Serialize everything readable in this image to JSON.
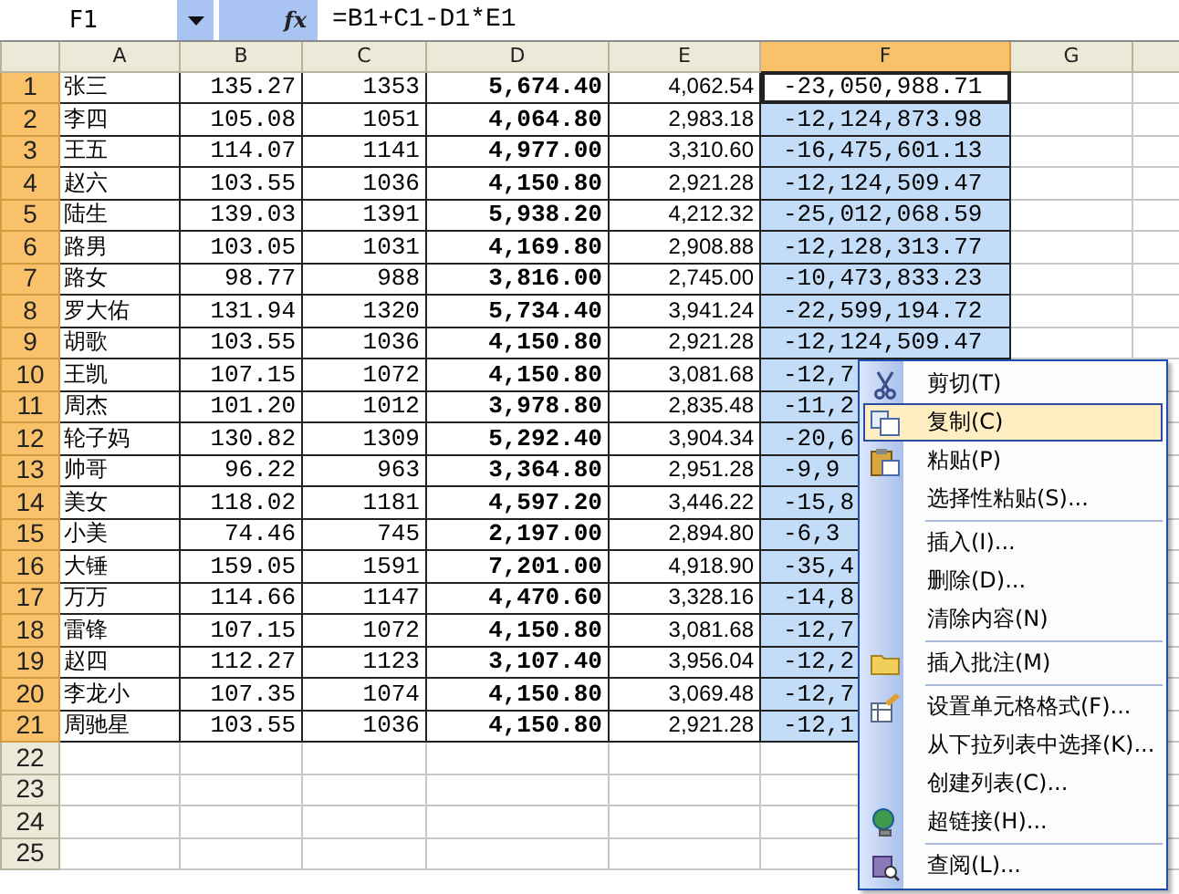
{
  "formula_bar": {
    "name_box": "F1",
    "function_label": "fx",
    "formula": "=B1+C1-D1*E1"
  },
  "sheet": {
    "columns": [
      {
        "label": "A",
        "selected": false
      },
      {
        "label": "B",
        "selected": false
      },
      {
        "label": "C",
        "selected": false
      },
      {
        "label": "D",
        "selected": false
      },
      {
        "label": "E",
        "selected": false
      },
      {
        "label": "F",
        "selected": true
      },
      {
        "label": "G",
        "selected": false
      }
    ],
    "rows": [
      {
        "header": "1",
        "selected": true,
        "active": true,
        "cells": [
          "张三",
          "135.27",
          "1353",
          "5,674.40",
          "4,062.54",
          "-23,050,988.71"
        ]
      },
      {
        "header": "2",
        "selected": true,
        "active": false,
        "cells": [
          "李四",
          "105.08",
          "1051",
          "4,064.80",
          "2,983.18",
          "-12,124,873.98"
        ]
      },
      {
        "header": "3",
        "selected": true,
        "active": false,
        "cells": [
          "王五",
          "114.07",
          "1141",
          "4,977.00",
          "3,310.60",
          "-16,475,601.13"
        ]
      },
      {
        "header": "4",
        "selected": true,
        "active": false,
        "cells": [
          "赵六",
          "103.55",
          "1036",
          "4,150.80",
          "2,921.28",
          "-12,124,509.47"
        ]
      },
      {
        "header": "5",
        "selected": true,
        "active": false,
        "cells": [
          "陆生",
          "139.03",
          "1391",
          "5,938.20",
          "4,212.32",
          "-25,012,068.59"
        ]
      },
      {
        "header": "6",
        "selected": true,
        "active": false,
        "cells": [
          "路男",
          "103.05",
          "1031",
          "4,169.80",
          "2,908.88",
          "-12,128,313.77"
        ]
      },
      {
        "header": "7",
        "selected": true,
        "active": false,
        "cells": [
          "路女",
          "98.77",
          "988",
          "3,816.00",
          "2,745.00",
          "-10,473,833.23"
        ]
      },
      {
        "header": "8",
        "selected": true,
        "active": false,
        "cells": [
          "罗大佑",
          "131.94",
          "1320",
          "5,734.40",
          "3,941.24",
          "-22,599,194.72"
        ]
      },
      {
        "header": "9",
        "selected": true,
        "active": false,
        "cells": [
          "胡歌",
          "103.55",
          "1036",
          "4,150.80",
          "2,921.28",
          "-12,124,509.47"
        ]
      },
      {
        "header": "10",
        "selected": true,
        "active": false,
        "cells": [
          "王凯",
          "107.15",
          "1072",
          "4,150.80",
          "3,081.68",
          "-12,7"
        ]
      },
      {
        "header": "11",
        "selected": true,
        "active": false,
        "cells": [
          "周杰",
          "101.20",
          "1012",
          "3,978.80",
          "2,835.48",
          "-11,2"
        ]
      },
      {
        "header": "12",
        "selected": true,
        "active": false,
        "cells": [
          "轮子妈",
          "130.82",
          "1309",
          "5,292.40",
          "3,904.34",
          "-20,6"
        ]
      },
      {
        "header": "13",
        "selected": true,
        "active": false,
        "cells": [
          "帅哥",
          "96.22",
          "963",
          "3,364.80",
          "2,951.28",
          "-9,9"
        ]
      },
      {
        "header": "14",
        "selected": true,
        "active": false,
        "cells": [
          "美女",
          "118.02",
          "1181",
          "4,597.20",
          "3,446.22",
          "-15,8"
        ]
      },
      {
        "header": "15",
        "selected": true,
        "active": false,
        "cells": [
          "小美",
          "74.46",
          "745",
          "2,197.00",
          "2,894.80",
          "-6,3"
        ]
      },
      {
        "header": "16",
        "selected": true,
        "active": false,
        "cells": [
          "大锤",
          "159.05",
          "1591",
          "7,201.00",
          "4,918.90",
          "-35,4"
        ]
      },
      {
        "header": "17",
        "selected": true,
        "active": false,
        "cells": [
          "万万",
          "114.66",
          "1147",
          "4,470.60",
          "3,328.16",
          "-14,8"
        ]
      },
      {
        "header": "18",
        "selected": true,
        "active": false,
        "cells": [
          "雷锋",
          "107.15",
          "1072",
          "4,150.80",
          "3,081.68",
          "-12,7"
        ]
      },
      {
        "header": "19",
        "selected": true,
        "active": false,
        "cells": [
          "赵四",
          "112.27",
          "1123",
          "3,107.40",
          "3,956.04",
          "-12,2"
        ]
      },
      {
        "header": "20",
        "selected": true,
        "active": false,
        "cells": [
          "李龙小",
          "107.35",
          "1074",
          "4,150.80",
          "3,069.48",
          "-12,7"
        ]
      },
      {
        "header": "21",
        "selected": true,
        "active": false,
        "cells": [
          "周驰星",
          "103.55",
          "1036",
          "4,150.80",
          "2,921.28",
          "-12,1"
        ]
      },
      {
        "header": "22",
        "selected": false
      },
      {
        "header": "23",
        "selected": false
      },
      {
        "header": "24",
        "selected": false
      },
      {
        "header": "25",
        "selected": false
      }
    ]
  },
  "context_menu": {
    "items": [
      {
        "kind": "item",
        "label": "剪切(T)",
        "selected": false
      },
      {
        "kind": "item",
        "label": "复制(C)",
        "selected": true
      },
      {
        "kind": "item",
        "label": "粘贴(P)",
        "selected": false
      },
      {
        "kind": "item",
        "label": "选择性粘贴(S)...",
        "selected": false
      },
      {
        "kind": "separator"
      },
      {
        "kind": "item",
        "label": "插入(I)...",
        "selected": false
      },
      {
        "kind": "item",
        "label": "删除(D)...",
        "selected": false
      },
      {
        "kind": "item",
        "label": "清除内容(N)",
        "selected": false
      },
      {
        "kind": "separator"
      },
      {
        "kind": "item",
        "label": "插入批注(M)",
        "selected": false
      },
      {
        "kind": "separator"
      },
      {
        "kind": "item",
        "label": "设置单元格格式(F)...",
        "selected": false
      },
      {
        "kind": "item",
        "label": "从下拉列表中选择(K)...",
        "selected": false
      },
      {
        "kind": "item",
        "label": "创建列表(C)...",
        "selected": false
      },
      {
        "kind": "item",
        "label": "超链接(H)...",
        "selected": false
      },
      {
        "kind": "separator"
      },
      {
        "kind": "item",
        "label": "查阅(L)...",
        "selected": false
      }
    ]
  }
}
